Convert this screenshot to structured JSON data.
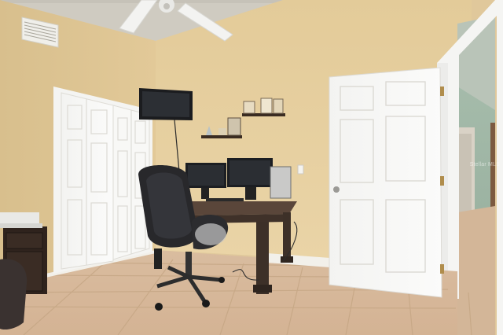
{
  "scene": {
    "description_label": "",
    "watermark": "Stellar MLS"
  },
  "colors": {
    "wall": "#e6cf9f",
    "wall_shadow": "#d9bf8c",
    "ceiling": "#c9c6bd",
    "floor": "#d8b999",
    "grout": "#c5a684",
    "door": "#f7f7f5",
    "desk": "#4b3a30",
    "chair": "#2b2b2e",
    "monitor": "#1d1f23",
    "hall_wall": "#9fb7a6"
  }
}
